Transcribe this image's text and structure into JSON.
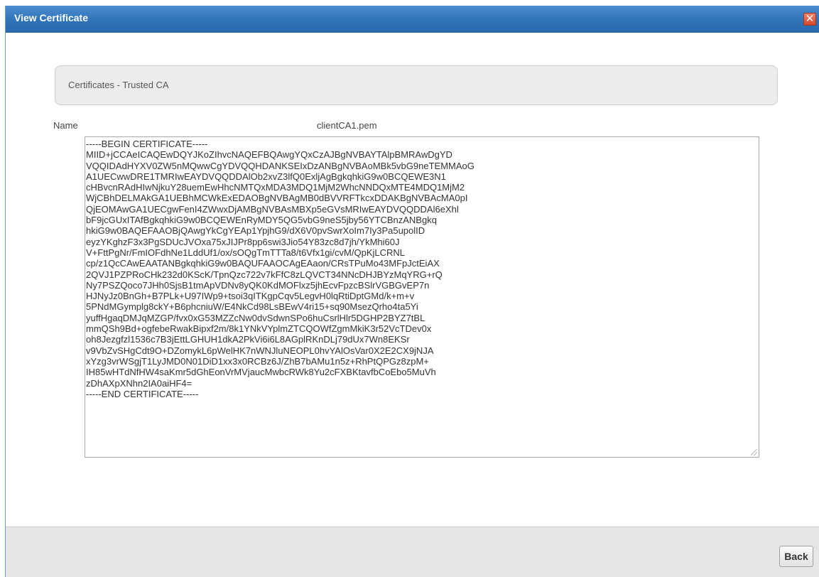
{
  "window": {
    "title": "View Certificate",
    "close_glyph": "✕"
  },
  "section": {
    "title": "Certificates - Trusted CA"
  },
  "certificate": {
    "name_label": "Name",
    "name_value": "clientCA1.pem",
    "pem": "-----BEGIN CERTIFICATE-----\nMIID+jCCAeICAQEwDQYJKoZIhvcNAQEFBQAwgYQxCzAJBgNVBAYTAlpBMRAwDgYD\nVQQIDAdHYXV0ZW5nMQwwCgYDVQQHDANKSEIxDzANBgNVBAoMBk5vbG9neTEMMAoG\nA1UECwwDRE1TMRIwEAYDVQQDDAlOb2xvZ3lfQ0ExljAgBgkqhkiG9w0BCQEWE3N1\ncHBvcnRAdHIwNjkuY28uemEwHhcNMTQxMDA3MDQ1MjM2WhcNNDQxMTE4MDQ1MjM2\nWjCBhDELMAkGA1UEBhMCWkExEDAOBgNVBAgMB0dBVVRFTkcxDDAKBgNVBAcMA0pI\nQjEOMAwGA1UECgwFenI4ZWwxDjAMBgNVBAsMBXp5eGVsMRIwEAYDVQQDDAl6eXhl\nbF9jcGUxITAfBgkqhkiG9w0BCQEWEnRyMDY5QG5vbG9neS5jby56YTCBnzANBgkq\nhkiG9w0BAQEFAAOBjQAwgYkCgYEAp1YpjhG9/dX6V0pvSwrXoIm7Iy3Pa5upolID\neyzYKghzF3x3PgSDUcJVOxa75xJIJPr8pp6swi3Jio54Y83zc8d7jh/YkMhi60J\nV+FttPgNr/FmIOFdhNe1LddUf1/ox/sOQgTmTTTa8/t6Vfx1gi/cvM/QpKjLCRNL\ncp/z1QcCAwEAATANBgkqhkiG9w0BAQUFAAOCAgEAaon/CRsTPuMo43MFpJctEiAX\n2QVJ1PZPRoCHk232d0KScK/TpnQzc722v7kFfC8zLQVCT34NNcDHJBYzMqYRG+rQ\nNy7PSZQoco7JHh0SjsB1tmApVDNv8yQK0KdMOFlxz5jhEcvFpzcBSlrVGBGvEP7n\nHJNyJz0BnGh+B7PLk+U97IWp9+tsoi3qITKgpCqv5LegvH0lqRtiDptGMd/k+m+v\n5PNdMGymplg8ckY+B6phcniuW/E4NkCd98LsBEwV4ri15+sq90MsezQrho4ta5Yi\nyuffHgaqDMJqMZGP/fvx0xG53MZZcNw0dvSdwnSPo6huCsrlHlr5DGHP2BYZ7tBL\nmmQSh9Bd+ogfebeRwakBipxf2m/8k1YNkVYplmZTCQOWfZgmMkiK3r52VcTDev0x\noh8Jezgfzl1536c7B3jEttLGHUH1dkA2PkVi6i6L8AGplRKnDLj79dUx7Wn8EKSr\nv9VbZvSHgCdt9O+DZomykL6pWelHK7nWNJluNEOPL0hvYAlOsVar0X2E2CX9jNJA\nxYzg3vrWSgjT1LyJMD0N01DiD1xx3x0RCBz6J/ZhB7bAMu1n5z+RhPtQPGz8zpM+\nIH85wHTdNfHW4saKmr5dGhEonVrMVjaucMwbcRWk8Yu2cFXBKtavfbCoEbo5MuVh\nzDhAXpXNhn2IA0aiHF4=\n-----END CERTIFICATE-----"
  },
  "footer": {
    "back_label": "Back"
  }
}
